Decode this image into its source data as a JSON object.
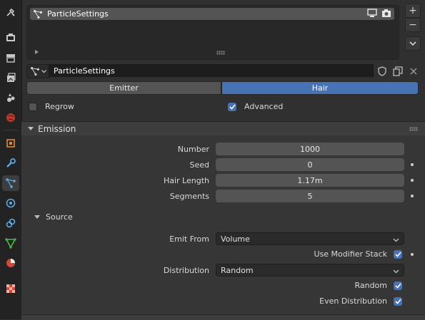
{
  "particle_list": {
    "items": [
      {
        "label": "ParticleSettings",
        "icon": "particles-icon"
      }
    ],
    "add_label": "+",
    "remove_label": "−",
    "menu_icon": "chevron-down-icon"
  },
  "datablock": {
    "name": "ParticleSettings",
    "type_icon": "particles-icon"
  },
  "type_toggle": {
    "options": [
      "Emitter",
      "Hair"
    ],
    "selected": "Hair"
  },
  "options": {
    "regrow": {
      "label": "Regrow",
      "checked": false
    },
    "advanced": {
      "label": "Advanced",
      "checked": true
    }
  },
  "emission": {
    "title": "Emission",
    "number": {
      "label": "Number",
      "value": "1000"
    },
    "seed": {
      "label": "Seed",
      "value": "0"
    },
    "hair_length": {
      "label": "Hair Length",
      "value": "1.17m"
    },
    "segments": {
      "label": "Segments",
      "value": "5"
    }
  },
  "source": {
    "title": "Source",
    "emit_from": {
      "label": "Emit From",
      "value": "Volume"
    },
    "use_modifier_stack": {
      "label": "Use Modifier Stack",
      "checked": true
    },
    "distribution": {
      "label": "Distribution",
      "value": "Random"
    },
    "random": {
      "label": "Random",
      "checked": true
    },
    "even_distribution": {
      "label": "Even Distribution",
      "checked": true
    }
  },
  "colors": {
    "accent": "#4772b3",
    "background": "#303030"
  }
}
